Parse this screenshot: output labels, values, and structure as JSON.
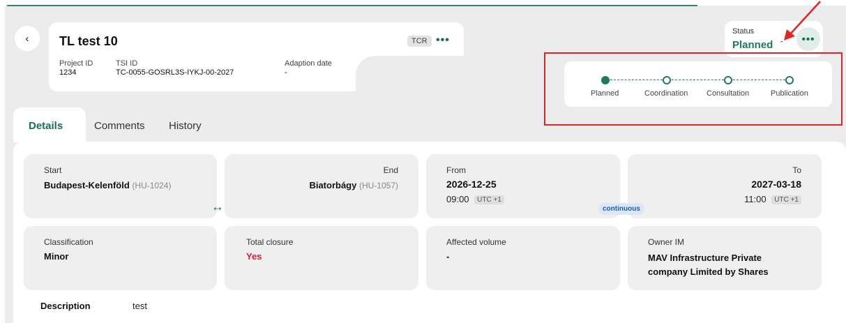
{
  "header": {
    "title": "TL test 10",
    "tag": "TCR",
    "project_id_label": "Project ID",
    "project_id": "1234",
    "tsi_id_label": "TSI ID",
    "tsi_id": "TC-0055-GOSRL3S-IYKJ-00-2027",
    "adaption_label": "Adaption date",
    "adaption_value": "-"
  },
  "status": {
    "label": "Status",
    "value": "Planned"
  },
  "progress": {
    "steps": [
      {
        "label": "Planned",
        "done": true
      },
      {
        "label": "Coordination",
        "done": false
      },
      {
        "label": "Consultation",
        "done": false
      },
      {
        "label": "Publication",
        "done": false
      }
    ]
  },
  "tabs": [
    {
      "label": "Details",
      "active": true
    },
    {
      "label": "Comments",
      "active": false
    },
    {
      "label": "History",
      "active": false
    }
  ],
  "route": {
    "start_label": "Start",
    "start_name": "Budapest-Kelenföld",
    "start_code": "(HU-1024)",
    "end_label": "End",
    "end_name": "Biatorbágy",
    "end_code": "(HU-1057)"
  },
  "period": {
    "from_label": "From",
    "from_date": "2026-12-25",
    "from_time": "09:00",
    "from_tz": "UTC +1",
    "to_label": "To",
    "to_date": "2027-03-18",
    "to_time": "11:00",
    "to_tz": "UTC +1",
    "mode": "continuous"
  },
  "details": {
    "classification_label": "Classification",
    "classification": "Minor",
    "closure_label": "Total closure",
    "closure": "Yes",
    "volume_label": "Affected volume",
    "volume": "-",
    "owner_label": "Owner IM",
    "owner": "MAV Infrastructure Private company Limited by Shares"
  },
  "description": {
    "label": "Description",
    "value": "test"
  },
  "colors": {
    "accent": "#1d7a5c",
    "danger": "#e02424",
    "closure_yes": "#e0193a"
  }
}
